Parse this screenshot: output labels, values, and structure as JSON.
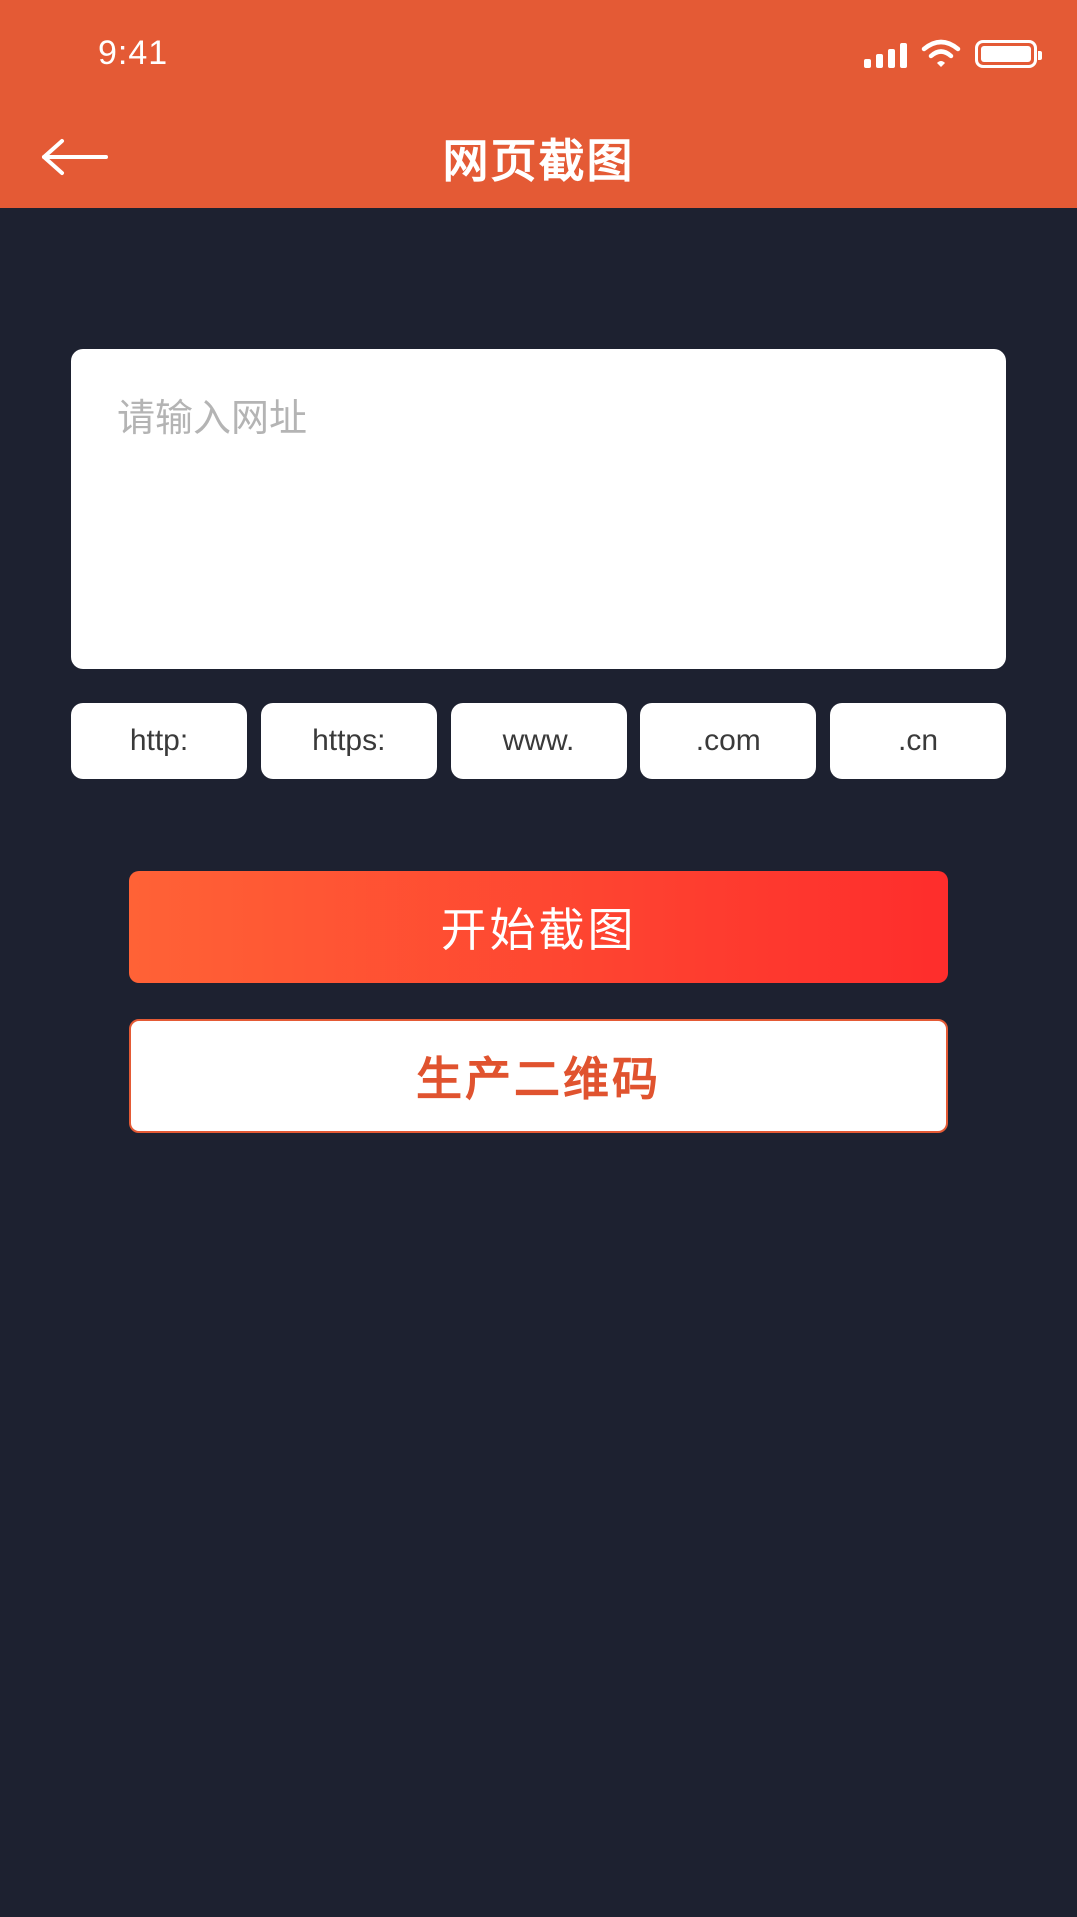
{
  "status_bar": {
    "time": "9:41"
  },
  "header": {
    "title": "网页截图",
    "back_icon": "arrow-left-icon"
  },
  "url_input": {
    "placeholder": "请输入网址",
    "value": ""
  },
  "quick_chips": [
    {
      "label": "http:"
    },
    {
      "label": "https:"
    },
    {
      "label": "www."
    },
    {
      "label": ".com"
    },
    {
      "label": ".cn"
    }
  ],
  "actions": {
    "start_label": "开始截图",
    "qr_label": "生产二维码"
  },
  "colors": {
    "header_bg": "#e45a35",
    "page_bg": "#1d2130",
    "accent_gradient_start": "#ff6236",
    "accent_gradient_end": "#fe2d2c",
    "qr_text": "#e0532f"
  }
}
